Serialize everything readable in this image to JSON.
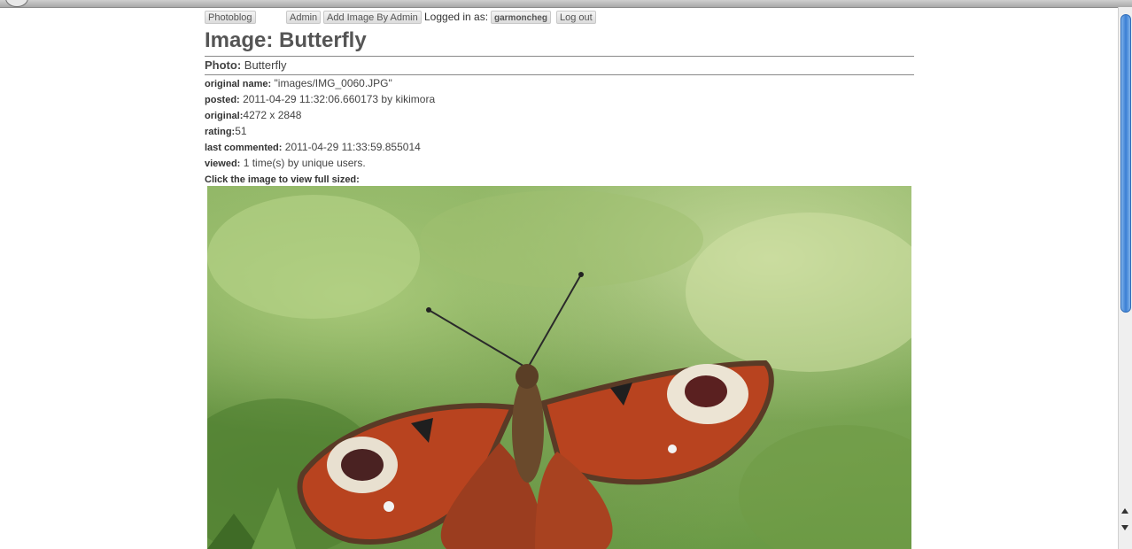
{
  "nav": {
    "photoblog": "Photoblog",
    "admin": "Admin",
    "add_image": "Add Image By Admin",
    "logged_in_label": "Logged in as:",
    "username": "garmoncheg",
    "logout": "Log out"
  },
  "title": "Image: Butterfly",
  "photo": {
    "label": "Photo:",
    "value": "Butterfly"
  },
  "meta": {
    "original_name_label": "original name:",
    "original_name_value": "\"images/IMG_0060.JPG\"",
    "posted_label": "posted:",
    "posted_value": "2011-04-29 11:32:06.660173 by kikimora",
    "original_label": "original:",
    "original_value": "4272 x 2848",
    "rating_label": "rating:",
    "rating_value": "51",
    "last_commented_label": "last commented:",
    "last_commented_value": "2011-04-29 11:33:59.855014",
    "viewed_label": "viewed:",
    "viewed_value": "1 time(s) by unique users.",
    "click_hint": "Click the image to view full sized:"
  },
  "image": {
    "subject": "peacock butterfly on leaves"
  }
}
